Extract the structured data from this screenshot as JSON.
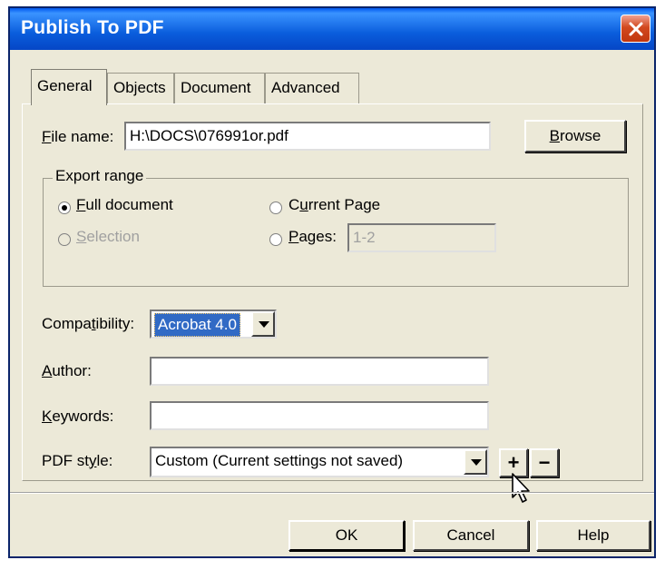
{
  "window": {
    "title": "Publish To PDF"
  },
  "tabs": [
    {
      "label": "General",
      "active": true
    },
    {
      "label": "Objects"
    },
    {
      "label": "Document"
    },
    {
      "label": "Advanced"
    }
  ],
  "file": {
    "label_u": "F",
    "label_rest": "ile name:",
    "value": "H:\\DOCS\\076991or.pdf",
    "browse_u": "B",
    "browse_rest": "rowse"
  },
  "export_range": {
    "legend": "Export range",
    "full_u": "F",
    "full_rest": "ull document",
    "selection_u": "S",
    "selection_rest": "election",
    "current_pre": "C",
    "current_u": "u",
    "current_rest": "rrent Page",
    "pages_u": "P",
    "pages_rest": "ages:",
    "pages_value": "1-2",
    "selected": "Full document"
  },
  "compat": {
    "label_pre": "Compa",
    "label_u": "t",
    "label_rest": "ibility:",
    "value": "Acrobat 4.0"
  },
  "author": {
    "label_u": "A",
    "label_rest": "uthor:",
    "value": ""
  },
  "keywords": {
    "label_u": "K",
    "label_rest": "eywords:",
    "value": ""
  },
  "pdf_style": {
    "label_pre": "PDF st",
    "label_u": "y",
    "label_rest": "le:",
    "value": "Custom (Current settings not saved)",
    "add": "+",
    "remove": "−"
  },
  "footer": {
    "ok": "OK",
    "cancel": "Cancel",
    "help": "Help"
  },
  "colors": {
    "titlebar": "#0a5ddc",
    "dialog_bg": "#ece9d8",
    "selection": "#316ac5"
  }
}
